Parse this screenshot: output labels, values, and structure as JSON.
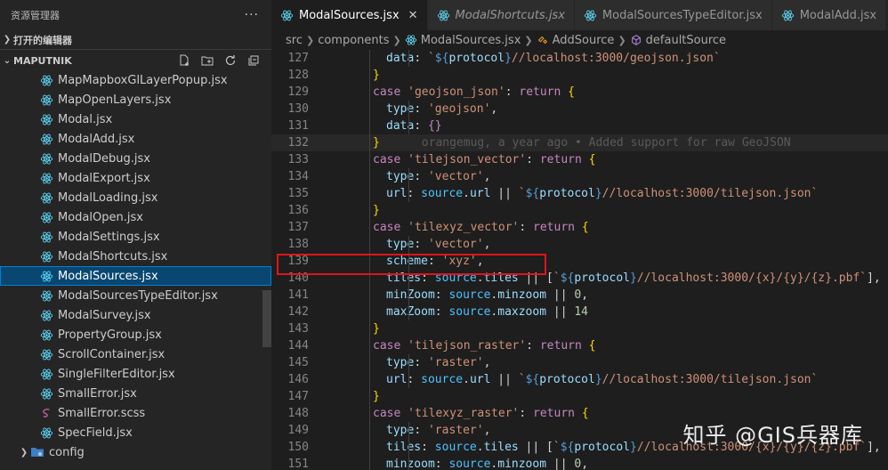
{
  "explorer": {
    "title": "资源管理器",
    "more": "···",
    "open_editors": "打开的编辑器",
    "project": "MAPUTNIK",
    "files": [
      {
        "name": "MapMapboxGlLayerPopup.jsx",
        "icon": "react-icon",
        "active": false
      },
      {
        "name": "MapOpenLayers.jsx",
        "icon": "react-icon",
        "active": false
      },
      {
        "name": "Modal.jsx",
        "icon": "react-icon",
        "active": false
      },
      {
        "name": "ModalAdd.jsx",
        "icon": "react-icon",
        "active": false
      },
      {
        "name": "ModalDebug.jsx",
        "icon": "react-icon",
        "active": false
      },
      {
        "name": "ModalExport.jsx",
        "icon": "react-icon",
        "active": false
      },
      {
        "name": "ModalLoading.jsx",
        "icon": "react-icon",
        "active": false
      },
      {
        "name": "ModalOpen.jsx",
        "icon": "react-icon",
        "active": false
      },
      {
        "name": "ModalSettings.jsx",
        "icon": "react-icon",
        "active": false
      },
      {
        "name": "ModalShortcuts.jsx",
        "icon": "react-icon",
        "active": false
      },
      {
        "name": "ModalSources.jsx",
        "icon": "react-icon",
        "active": true
      },
      {
        "name": "ModalSourcesTypeEditor.jsx",
        "icon": "react-icon",
        "active": false
      },
      {
        "name": "ModalSurvey.jsx",
        "icon": "react-icon",
        "active": false
      },
      {
        "name": "PropertyGroup.jsx",
        "icon": "react-icon",
        "active": false
      },
      {
        "name": "ScrollContainer.jsx",
        "icon": "react-icon",
        "active": false
      },
      {
        "name": "SingleFilterEditor.jsx",
        "icon": "react-icon",
        "active": false
      },
      {
        "name": "SmallError.jsx",
        "icon": "react-icon",
        "active": false
      },
      {
        "name": "SmallError.scss",
        "icon": "sass-icon",
        "active": false
      },
      {
        "name": "SpecField.jsx",
        "icon": "react-icon",
        "active": false
      }
    ],
    "folder": "config"
  },
  "tabs": [
    {
      "label": "ModalSources.jsx",
      "active": true,
      "italic": false
    },
    {
      "label": "ModalShortcuts.jsx",
      "active": false,
      "italic": true
    },
    {
      "label": "ModalSourcesTypeEditor.jsx",
      "active": false,
      "italic": false
    },
    {
      "label": "ModalAdd.jsx",
      "active": false,
      "italic": false
    }
  ],
  "breadcrumb": [
    "src",
    "components",
    "ModalSources.jsx",
    "AddSource",
    "defaultSource"
  ],
  "code": [
    {
      "n": "127",
      "indent": 2,
      "parts": [
        [
          "t-key",
          "data"
        ],
        [
          "t-plain",
          ": "
        ],
        [
          "t-str",
          "`"
        ],
        [
          "t-tmpl",
          "${"
        ],
        [
          "t-key",
          "protocol"
        ],
        [
          "t-tmpl",
          "}"
        ],
        [
          "t-str",
          "//localhost:3000/geojson.json`"
        ]
      ]
    },
    {
      "n": "128",
      "indent": 1,
      "parts": [
        [
          "t-br",
          "}"
        ]
      ]
    },
    {
      "n": "129",
      "indent": 1,
      "parts": [
        [
          "t-kw",
          "case "
        ],
        [
          "t-str",
          "'geojson_json'"
        ],
        [
          "t-plain",
          ": "
        ],
        [
          "t-kw",
          "return "
        ],
        [
          "t-br",
          "{"
        ]
      ]
    },
    {
      "n": "130",
      "indent": 2,
      "parts": [
        [
          "t-key",
          "type"
        ],
        [
          "t-plain",
          ": "
        ],
        [
          "t-str",
          "'geojson'"
        ],
        [
          "t-plain",
          ","
        ]
      ]
    },
    {
      "n": "131",
      "indent": 2,
      "parts": [
        [
          "t-key",
          "data"
        ],
        [
          "t-plain",
          ": "
        ],
        [
          "t-kw",
          "{}"
        ]
      ]
    },
    {
      "n": "132",
      "indent": 1,
      "blame": true,
      "parts": [
        [
          "t-br",
          "}"
        ],
        [
          "blame",
          "      orangemug, a year ago • Added support for raw GeoJSON"
        ]
      ]
    },
    {
      "n": "133",
      "indent": 1,
      "parts": [
        [
          "t-kw",
          "case "
        ],
        [
          "t-str",
          "'tilejson_vector'"
        ],
        [
          "t-plain",
          ": "
        ],
        [
          "t-kw",
          "return "
        ],
        [
          "t-br",
          "{"
        ]
      ]
    },
    {
      "n": "134",
      "indent": 2,
      "parts": [
        [
          "t-key",
          "type"
        ],
        [
          "t-plain",
          ": "
        ],
        [
          "t-str",
          "'vector'"
        ],
        [
          "t-plain",
          ","
        ]
      ]
    },
    {
      "n": "135",
      "indent": 2,
      "parts": [
        [
          "t-key",
          "url"
        ],
        [
          "t-plain",
          ": "
        ],
        [
          "t-var",
          "source"
        ],
        [
          "t-plain",
          "."
        ],
        [
          "t-key",
          "url"
        ],
        [
          "t-plain",
          " || "
        ],
        [
          "t-str",
          "`"
        ],
        [
          "t-tmpl",
          "${"
        ],
        [
          "t-key",
          "protocol"
        ],
        [
          "t-tmpl",
          "}"
        ],
        [
          "t-str",
          "//localhost:3000/tilejson.json`"
        ]
      ]
    },
    {
      "n": "136",
      "indent": 1,
      "parts": [
        [
          "t-br",
          "}"
        ]
      ]
    },
    {
      "n": "137",
      "indent": 1,
      "parts": [
        [
          "t-kw",
          "case "
        ],
        [
          "t-str",
          "'tilexyz_vector'"
        ],
        [
          "t-plain",
          ": "
        ],
        [
          "t-kw",
          "return "
        ],
        [
          "t-br",
          "{"
        ]
      ]
    },
    {
      "n": "138",
      "indent": 2,
      "parts": [
        [
          "t-key",
          "type"
        ],
        [
          "t-plain",
          ": "
        ],
        [
          "t-str",
          "'vector'"
        ],
        [
          "t-plain",
          ","
        ]
      ]
    },
    {
      "n": "139",
      "indent": 2,
      "parts": [
        [
          "t-key",
          "scheme"
        ],
        [
          "t-plain",
          ": "
        ],
        [
          "t-str",
          "'xyz'"
        ],
        [
          "t-plain",
          ","
        ]
      ]
    },
    {
      "n": "140",
      "indent": 2,
      "parts": [
        [
          "t-key",
          "tiles"
        ],
        [
          "t-plain",
          ": "
        ],
        [
          "t-var",
          "source"
        ],
        [
          "t-plain",
          "."
        ],
        [
          "t-key",
          "tiles"
        ],
        [
          "t-plain",
          " || ["
        ],
        [
          "t-str",
          "`"
        ],
        [
          "t-tmpl",
          "${"
        ],
        [
          "t-key",
          "protocol"
        ],
        [
          "t-tmpl",
          "}"
        ],
        [
          "t-str",
          "//localhost:3000/{x}/{y}/{z}.pbf`"
        ],
        [
          "t-plain",
          "],"
        ]
      ]
    },
    {
      "n": "141",
      "indent": 2,
      "parts": [
        [
          "t-key",
          "minZoom"
        ],
        [
          "t-plain",
          ": "
        ],
        [
          "t-var",
          "source"
        ],
        [
          "t-plain",
          "."
        ],
        [
          "t-key",
          "minzoom"
        ],
        [
          "t-plain",
          " || "
        ],
        [
          "t-num",
          "0"
        ],
        [
          "t-plain",
          ","
        ]
      ]
    },
    {
      "n": "142",
      "indent": 2,
      "parts": [
        [
          "t-key",
          "maxZoom"
        ],
        [
          "t-plain",
          ": "
        ],
        [
          "t-var",
          "source"
        ],
        [
          "t-plain",
          "."
        ],
        [
          "t-key",
          "maxzoom"
        ],
        [
          "t-plain",
          " || "
        ],
        [
          "t-num",
          "14"
        ]
      ]
    },
    {
      "n": "143",
      "indent": 1,
      "parts": [
        [
          "t-br",
          "}"
        ]
      ]
    },
    {
      "n": "144",
      "indent": 1,
      "parts": [
        [
          "t-kw",
          "case "
        ],
        [
          "t-str",
          "'tilejson_raster'"
        ],
        [
          "t-plain",
          ": "
        ],
        [
          "t-kw",
          "return "
        ],
        [
          "t-br",
          "{"
        ]
      ]
    },
    {
      "n": "145",
      "indent": 2,
      "parts": [
        [
          "t-key",
          "type"
        ],
        [
          "t-plain",
          ": "
        ],
        [
          "t-str",
          "'raster'"
        ],
        [
          "t-plain",
          ","
        ]
      ]
    },
    {
      "n": "146",
      "indent": 2,
      "parts": [
        [
          "t-key",
          "url"
        ],
        [
          "t-plain",
          ": "
        ],
        [
          "t-var",
          "source"
        ],
        [
          "t-plain",
          "."
        ],
        [
          "t-key",
          "url"
        ],
        [
          "t-plain",
          " || "
        ],
        [
          "t-str",
          "`"
        ],
        [
          "t-tmpl",
          "${"
        ],
        [
          "t-key",
          "protocol"
        ],
        [
          "t-tmpl",
          "}"
        ],
        [
          "t-str",
          "//localhost:3000/tilejson.json`"
        ]
      ]
    },
    {
      "n": "147",
      "indent": 1,
      "parts": [
        [
          "t-br",
          "}"
        ]
      ]
    },
    {
      "n": "148",
      "indent": 1,
      "parts": [
        [
          "t-kw",
          "case "
        ],
        [
          "t-str",
          "'tilexyz_raster'"
        ],
        [
          "t-plain",
          ": "
        ],
        [
          "t-kw",
          "return "
        ],
        [
          "t-br",
          "{"
        ]
      ]
    },
    {
      "n": "149",
      "indent": 2,
      "parts": [
        [
          "t-key",
          "type"
        ],
        [
          "t-plain",
          ": "
        ],
        [
          "t-str",
          "'raster'"
        ],
        [
          "t-plain",
          ","
        ]
      ]
    },
    {
      "n": "150",
      "indent": 2,
      "parts": [
        [
          "t-key",
          "tiles"
        ],
        [
          "t-plain",
          ": "
        ],
        [
          "t-var",
          "source"
        ],
        [
          "t-plain",
          "."
        ],
        [
          "t-key",
          "tiles"
        ],
        [
          "t-plain",
          " || ["
        ],
        [
          "t-str",
          "`"
        ],
        [
          "t-tmpl",
          "${"
        ],
        [
          "t-key",
          "protocol"
        ],
        [
          "t-tmpl",
          "}"
        ],
        [
          "t-str",
          "//localhost:3000/{x}/{y}/{z}.pbf`"
        ],
        [
          "t-plain",
          "],"
        ]
      ]
    },
    {
      "n": "151",
      "indent": 2,
      "parts": [
        [
          "t-key",
          "minzoom"
        ],
        [
          "t-plain",
          ": "
        ],
        [
          "t-var",
          "source"
        ],
        [
          "t-plain",
          "."
        ],
        [
          "t-key",
          "minzoom"
        ],
        [
          "t-plain",
          " || "
        ],
        [
          "t-num",
          "0"
        ],
        [
          "t-plain",
          ","
        ]
      ]
    }
  ],
  "watermark": "知乎 @GIS兵器库",
  "colors": {
    "react": "#61dafb",
    "sass": "#cd6799",
    "highlight": "#e0141a",
    "selection": "#094771"
  }
}
